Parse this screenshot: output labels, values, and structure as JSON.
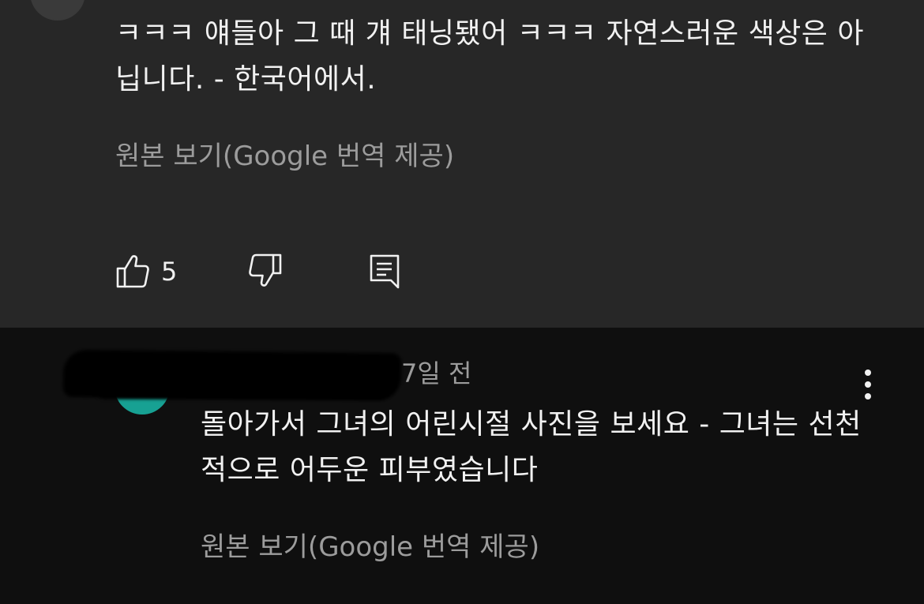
{
  "comments": [
    {
      "text": "ㅋㅋㅋ 얘들아 그 때 걔 태닝됐어 ㅋㅋㅋ 자연스러운 색상은 아닙니다. - 한국어에서.",
      "translation_link": "원본 보기(Google 번역 제공)",
      "actions": {
        "like_icon": "thumbs-up-icon",
        "like_count": "5",
        "dislike_icon": "thumbs-down-icon",
        "reply_icon": "reply-icon"
      },
      "more_icon": "more-vertical-icon"
    },
    {
      "timestamp": "7일 전",
      "text": "돌아가서 그녀의 어린시절 사진을 보세요 - 그녀는 선천적으로 어두운 피부였습니다",
      "translation_link": "원본 보기(Google 번역 제공)",
      "more_icon": "more-vertical-icon",
      "avatar_color": "#17a193"
    }
  ],
  "colors": {
    "highlight_background": "#272727",
    "background": "#0f0f0f",
    "primary_text": "#f1f1f1",
    "secondary_text": "#9c9c9c"
  }
}
